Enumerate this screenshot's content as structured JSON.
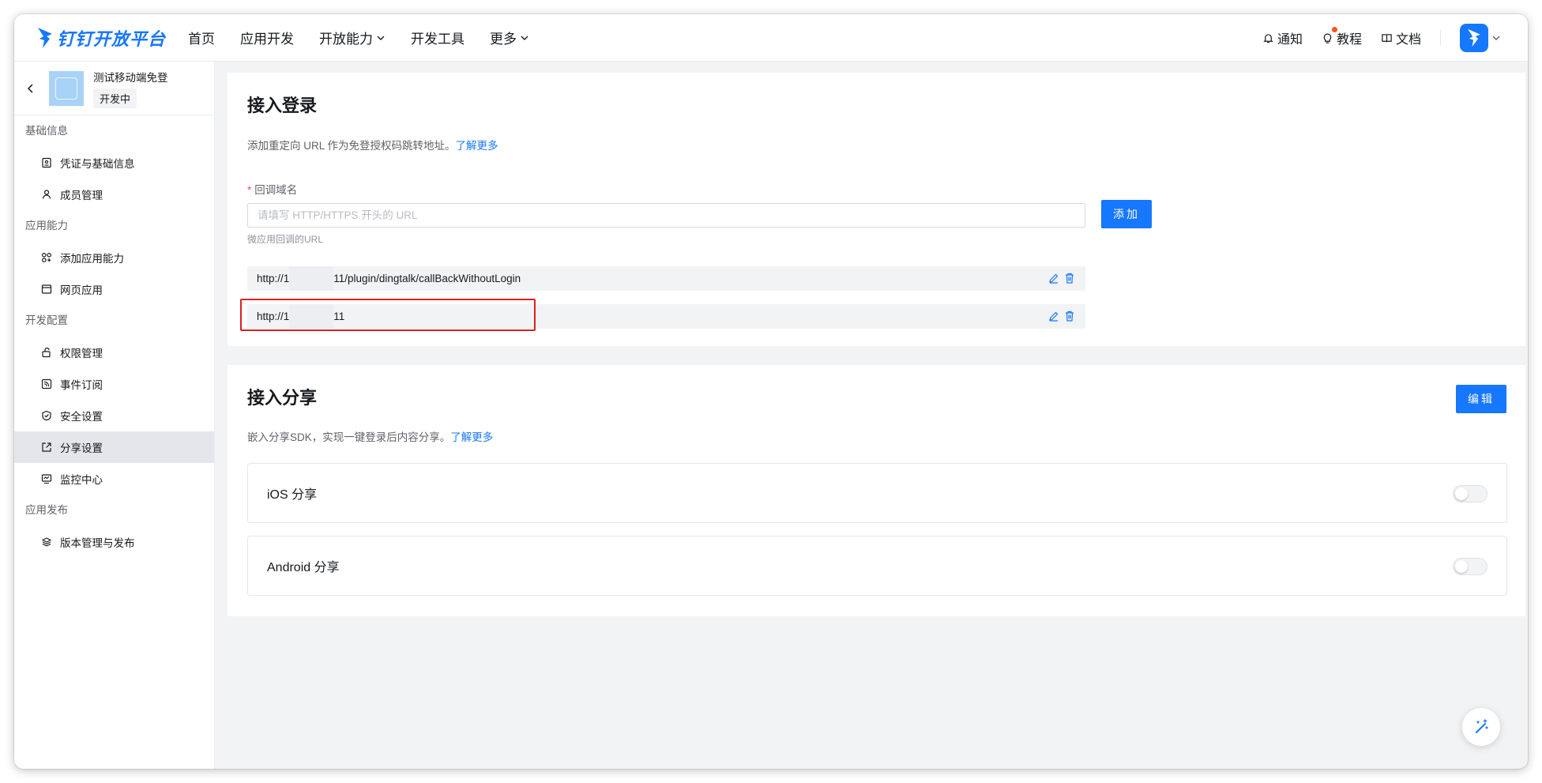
{
  "header": {
    "logo_text": "钉钉开放平台",
    "nav": [
      {
        "label": "首页",
        "has_dropdown": false
      },
      {
        "label": "应用开发",
        "has_dropdown": false
      },
      {
        "label": "开放能力",
        "has_dropdown": true
      },
      {
        "label": "开发工具",
        "has_dropdown": false
      },
      {
        "label": "更多",
        "has_dropdown": true
      }
    ],
    "right": {
      "notify_label": "通知",
      "tutorial_label": "教程",
      "docs_label": "文档"
    }
  },
  "sidebar": {
    "app_name": "测试移动端免登",
    "app_status": "开发中",
    "groups": [
      {
        "label": "基础信息",
        "items": [
          {
            "label": "凭证与基础信息",
            "icon": "credential-icon"
          },
          {
            "label": "成员管理",
            "icon": "user-icon"
          }
        ]
      },
      {
        "label": "应用能力",
        "items": [
          {
            "label": "添加应用能力",
            "icon": "apps-add-icon"
          },
          {
            "label": "网页应用",
            "icon": "browser-icon"
          }
        ]
      },
      {
        "label": "开发配置",
        "items": [
          {
            "label": "权限管理",
            "icon": "lock-icon"
          },
          {
            "label": "事件订阅",
            "icon": "subscribe-icon"
          },
          {
            "label": "安全设置",
            "icon": "shield-icon"
          },
          {
            "label": "分享设置",
            "icon": "share-icon",
            "active": true
          },
          {
            "label": "监控中心",
            "icon": "monitor-icon"
          }
        ]
      },
      {
        "label": "应用发布",
        "items": [
          {
            "label": "版本管理与发布",
            "icon": "layers-icon"
          }
        ]
      }
    ]
  },
  "login": {
    "title": "接入登录",
    "desc": "添加重定向 URL 作为免登授权码跳转地址。",
    "learn_more": "了解更多",
    "field_label": "回调域名",
    "input_placeholder": "请填写 HTTP/HTTPS 开头的 URL",
    "add_button": "添加",
    "hint": "微应用回调的URL",
    "urls": [
      {
        "prefix": "http://1",
        "suffix": "11/plugin/dingtalk/callBackWithoutLogin"
      },
      {
        "prefix": "http://1",
        "suffix": "11"
      }
    ]
  },
  "share": {
    "title": "接入分享",
    "edit_button": "编辑",
    "desc": "嵌入分享SDK，实现一键登录后内容分享。",
    "learn_more": "了解更多",
    "options": [
      {
        "label": "iOS 分享",
        "enabled": false
      },
      {
        "label": "Android 分享",
        "enabled": false
      }
    ]
  },
  "colors": {
    "brand": "#1677ff",
    "highlight_box": "#e02020",
    "active_bg": "#e5e6eb"
  }
}
